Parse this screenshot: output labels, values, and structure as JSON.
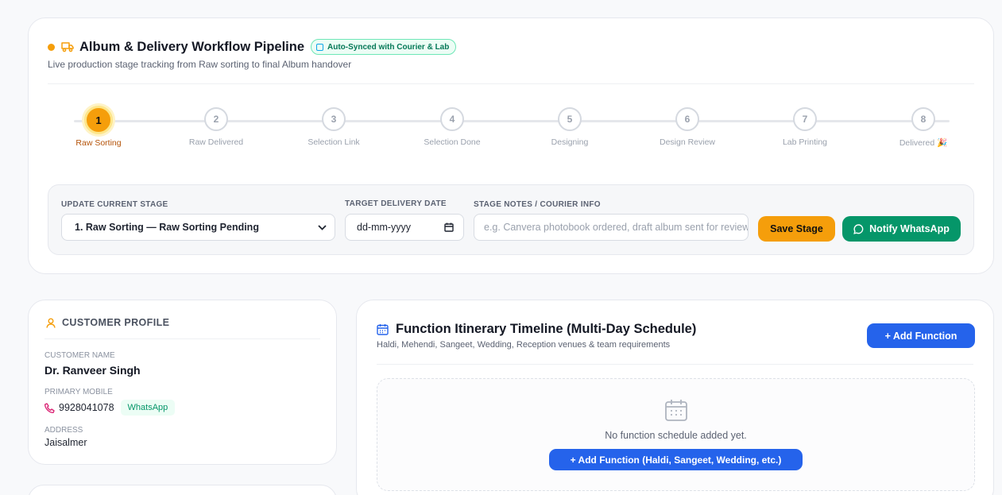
{
  "pipeline": {
    "title": "Album & Delivery Workflow Pipeline",
    "badge": "Auto-Synced with Courier & Lab",
    "subtitle": "Live production stage tracking from Raw sorting to final Album handover",
    "steps": [
      {
        "num": "1",
        "label": "Raw Sorting",
        "active": true
      },
      {
        "num": "2",
        "label": "Raw Delivered"
      },
      {
        "num": "3",
        "label": "Selection Link"
      },
      {
        "num": "4",
        "label": "Selection Done"
      },
      {
        "num": "5",
        "label": "Designing"
      },
      {
        "num": "6",
        "label": "Design Review"
      },
      {
        "num": "7",
        "label": "Lab Printing"
      },
      {
        "num": "8",
        "label": "Delivered 🎉"
      }
    ],
    "form": {
      "stage_label": "UPDATE CURRENT STAGE",
      "stage_value": "1. Raw Sorting — Raw Sorting Pending",
      "date_label": "TARGET DELIVERY DATE",
      "date_placeholder": "dd-mm-yyyy",
      "notes_label": "STAGE NOTES / COURIER INFO",
      "notes_placeholder": "e.g. Canvera photobook ordered, draft album sent for review",
      "save_label": "Save Stage",
      "notify_label": "Notify WhatsApp"
    }
  },
  "profile": {
    "heading": "CUSTOMER PROFILE",
    "name_label": "CUSTOMER NAME",
    "name": "Dr. Ranveer Singh",
    "mobile_label": "PRIMARY MOBILE",
    "mobile": "9928041078",
    "whatsapp_tag": "WhatsApp",
    "address_label": "ADDRESS",
    "address": "Jaisalmer"
  },
  "itinerary": {
    "title": "Function Itinerary Timeline (Multi-Day Schedule)",
    "subtitle": "Haldi, Mehendi, Sangeet, Wedding, Reception venues & team requirements",
    "add_label": "+ Add Function",
    "empty_text": "No function schedule added yet.",
    "empty_button": "+ Add Function (Haldi, Sangeet, Wedding, etc.)"
  },
  "colors": {
    "accent_orange": "#f59e0b",
    "accent_green": "#059669",
    "accent_blue": "#2563eb"
  }
}
